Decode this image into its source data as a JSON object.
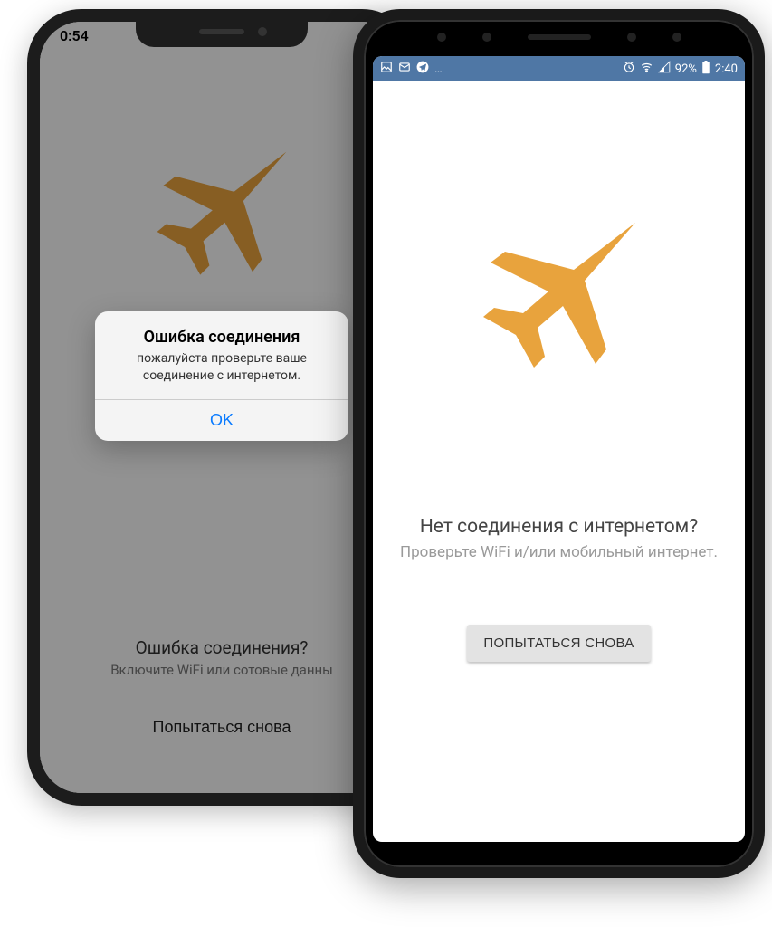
{
  "colors": {
    "plane": "#e8a33d",
    "android_statusbar": "#4f77a5",
    "ios_link": "#0a7bff"
  },
  "iphone": {
    "time": "0:54",
    "alert": {
      "title": "Ошибка соединения",
      "message": "пожалуйста проверьте ваше соединение с интернетом.",
      "ok_label": "OK"
    },
    "error_title": "Ошибка соединения?",
    "error_subtitle": "Включите WiFi или сотовые данны",
    "retry_label": "Попытаться снова"
  },
  "android": {
    "status": {
      "left_icons": [
        "image-icon",
        "mail-icon",
        "telegram-icon",
        "more-icon"
      ],
      "right_icons": [
        "alarm-icon",
        "wifi-icon",
        "signal-icon"
      ],
      "battery_pct": "92%",
      "time": "2:40"
    },
    "error_title": "Нет соединения с интернетом?",
    "error_subtitle": "Проверьте WiFi и/или мобильный интернет.",
    "retry_label": "ПОПЫТАТЬСЯ СНОВА"
  }
}
